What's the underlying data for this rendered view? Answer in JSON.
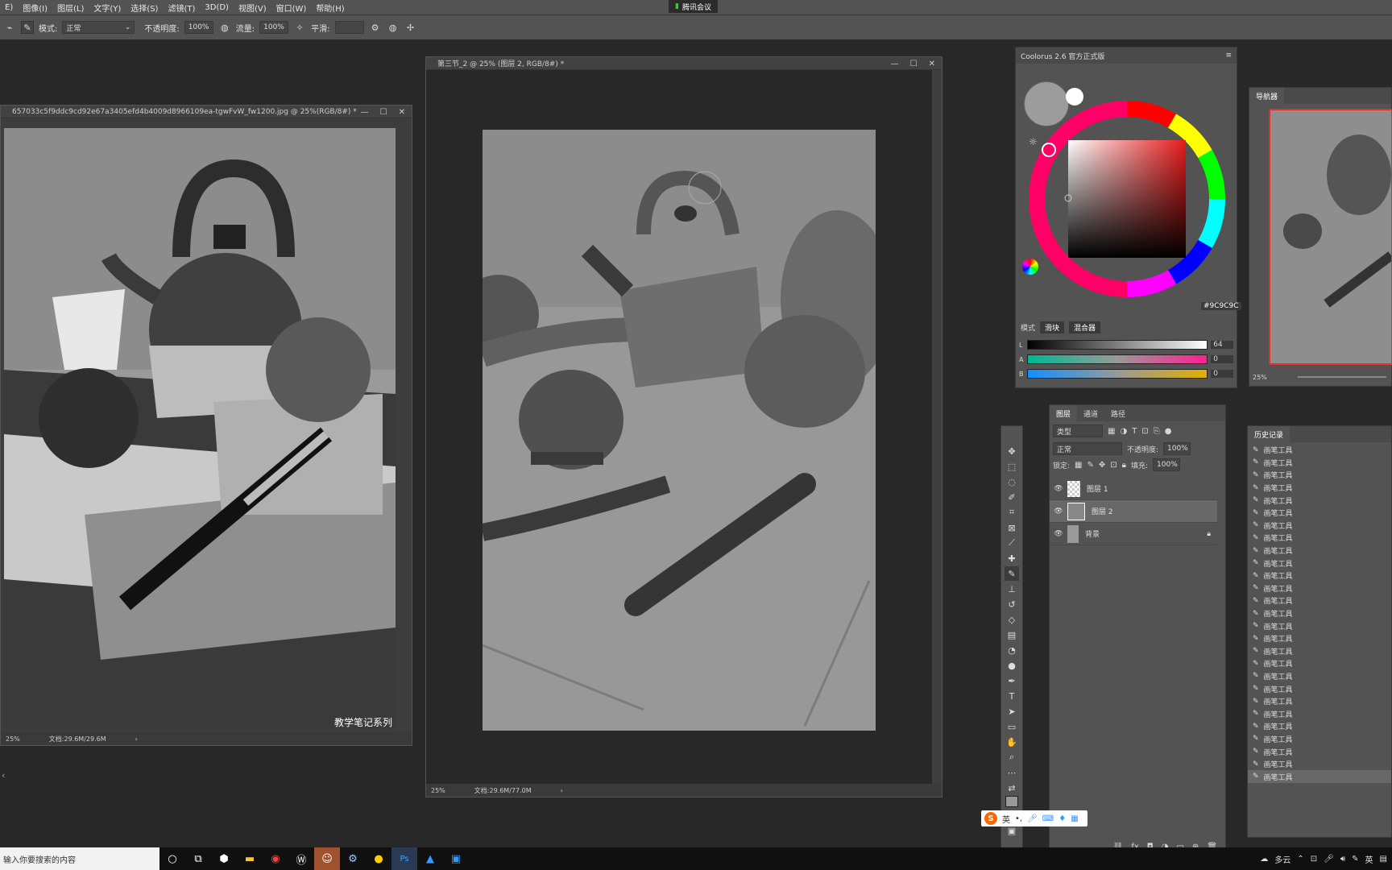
{
  "menubar": {
    "items": [
      "E)",
      "图像(I)",
      "图层(L)",
      "文字(Y)",
      "选择(S)",
      "滤镜(T)",
      "3D(D)",
      "视图(V)",
      "窗口(W)",
      "帮助(H)"
    ],
    "meeting": "腾讯会议"
  },
  "options": {
    "mode_label": "模式:",
    "mode_value": "正常",
    "opacity_label": "不透明度:",
    "opacity_value": "100%",
    "flow_label": "流量:",
    "flow_value": "100%",
    "smooth_label": "平滑:"
  },
  "ref_doc": {
    "title": "657033c5f9ddc9cd92e67a3405efd4b4009d8966109ea-tgwFvW_fw1200.jpg @ 25%(RGB/8#) *",
    "zoom": "25%",
    "doc_size": "文档:29.6M/29.6M",
    "watermark": "教学笔记系列"
  },
  "main_doc": {
    "title": "第三节_2 @ 25% (图层 2, RGB/8#) *",
    "zoom": "25%",
    "doc_size": "文档:29.6M/77.0M"
  },
  "coolorus": {
    "title": "Coolorus 2.6 官方正式版",
    "hex": "#9C9C9C",
    "mode_label": "模式",
    "btn_slider": "滑块",
    "btn_mixer": "混合器",
    "slider_labels": [
      "L",
      "A",
      "B"
    ],
    "slider_values": [
      "64",
      "0",
      "0"
    ]
  },
  "navigator": {
    "title": "导航器",
    "zoom": "25%"
  },
  "layers_panel": {
    "tabs": [
      "图层",
      "通道",
      "路径"
    ],
    "filter": "类型",
    "blend": "正常",
    "opacity_label": "不透明度:",
    "opacity_value": "100%",
    "lock_label": "锁定:",
    "fill_label": "填充:",
    "fill_value": "100%",
    "layers": [
      "图层 1",
      "图层 2",
      "背景"
    ]
  },
  "history": {
    "title": "历史记录",
    "item": "画笔工具",
    "count": 27
  },
  "ime": {
    "label": "英"
  },
  "taskbar": {
    "search": "输入你要搜索的内容",
    "weather": "多云",
    "lang": "英"
  }
}
